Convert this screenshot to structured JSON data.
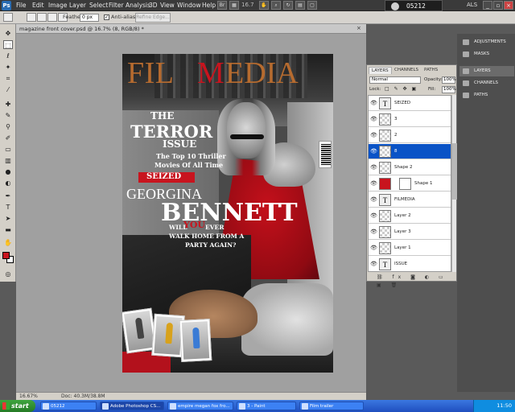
{
  "app": {
    "logo": "Ps",
    "menus": [
      "File",
      "Edit",
      "Image",
      "Layer",
      "Select",
      "Filter",
      "Analysis",
      "3D",
      "View",
      "Window",
      "Help"
    ],
    "zoom_menu": "16.7",
    "user": "05212",
    "workspace": "ALS"
  },
  "options": {
    "feather_label": "Feather:",
    "feather_value": "0 px",
    "antialias_label": "Anti-alias",
    "antialias_checked": "✓",
    "refine_label": "Refine Edge..."
  },
  "document": {
    "title": "magazine front cover.psd @ 16.7% (8, RGB/8) *",
    "zoom": "16.67%",
    "doc_size": "Doc: 40.3M/38.8M"
  },
  "cover": {
    "title_a": "FIL",
    "title_b": "M",
    "title_c": "EDIA",
    "the": "THE",
    "terror": "TERROR",
    "issue": "ISSUE",
    "top10_a": "The Top 10 Thriller",
    "top10_b": "Movies Of All Time",
    "seized": "SEIZED",
    "georgina": "GEORGINA",
    "bennett": "BENNETT",
    "will": "WILL",
    "you": "YOU",
    "ever": "EVER",
    "walk": "WALK HOME FROM A",
    "party": "PARTY AGAIN?"
  },
  "layers_panel": {
    "tabs": [
      "LAYERS",
      "CHANNELS",
      "PATHS"
    ],
    "blend_mode": "Normal",
    "opacity_label": "Opacity:",
    "opacity": "100%",
    "lock_label": "Lock:",
    "fill_label": "Fill:",
    "fill": "100%",
    "layers": [
      {
        "name": "SEIZED",
        "thumb": "T"
      },
      {
        "name": "3",
        "thumb": ""
      },
      {
        "name": "2",
        "thumb": ""
      },
      {
        "name": "8",
        "thumb": ""
      },
      {
        "name": "Shape 2",
        "thumb": ""
      },
      {
        "name": "Shape 1",
        "thumb": ""
      },
      {
        "name": "FILMEDIA",
        "thumb": "T"
      },
      {
        "name": "Layer 2",
        "thumb": ""
      },
      {
        "name": "Layer 3",
        "thumb": ""
      },
      {
        "name": "Layer 1",
        "thumb": ""
      },
      {
        "name": "ISSUE",
        "thumb": "T"
      }
    ]
  },
  "side_panels": [
    "ADJUSTMENTS",
    "MASKS",
    "LAYERS",
    "CHANNELS",
    "PATHS"
  ],
  "taskbar": {
    "start": "start",
    "tasks": [
      "05212",
      "Adobe Photoshop CS...",
      "empire megan fox fro...",
      "3 - Paint",
      "Film trailer"
    ],
    "clock": "11:50"
  }
}
